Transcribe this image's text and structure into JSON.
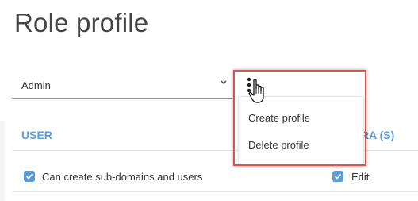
{
  "page": {
    "title": "Role profile"
  },
  "profile_select": {
    "value": "Admin"
  },
  "menu": {
    "items": [
      {
        "label": "Create profile"
      },
      {
        "label": "Delete profile"
      }
    ]
  },
  "sections": {
    "user": "USER",
    "extra_visible": "RA (S)"
  },
  "permissions": {
    "user": [
      {
        "label": "Can create sub-domains and users",
        "checked": true
      }
    ],
    "extra": [
      {
        "label": "Edit",
        "checked": true
      }
    ]
  },
  "colors": {
    "accent": "#5b9bd5",
    "highlight": "#d9534f"
  },
  "icons": {
    "chevron": "chevron-down-icon",
    "kebab": "kebab-menu-icon",
    "cursor": "hand-pointer-icon",
    "check": "check-icon"
  }
}
